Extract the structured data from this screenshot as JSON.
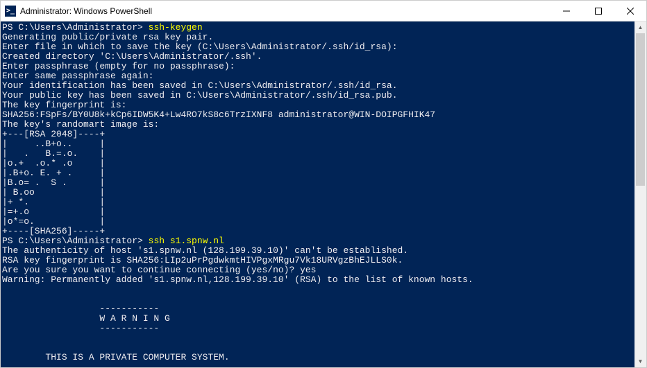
{
  "titlebar": {
    "icon_glyph": ">_",
    "title": "Administrator: Windows PowerShell"
  },
  "session": {
    "prompt1": "PS C:\\Users\\Administrator> ",
    "command1": "ssh-keygen",
    "output1_lines": [
      "Generating public/private rsa key pair.",
      "Enter file in which to save the key (C:\\Users\\Administrator/.ssh/id_rsa):",
      "Created directory 'C:\\Users\\Administrator/.ssh'.",
      "Enter passphrase (empty for no passphrase):",
      "Enter same passphrase again:",
      "Your identification has been saved in C:\\Users\\Administrator/.ssh/id_rsa.",
      "Your public key has been saved in C:\\Users\\Administrator/.ssh/id_rsa.pub.",
      "The key fingerprint is:",
      "SHA256:FSpFs/BY0U8k+kCp6IDW5K4+Lw4RO7kS8c6TrzIXNF8 administrator@WIN-DOIPGFHIK47",
      "The key's randomart image is:",
      "+---[RSA 2048]----+",
      "|     ..B+o..     |",
      "|   .   B.=.o.    |",
      "|o.+  .o.* .o     |",
      "|.B+o. E. + .     |",
      "|B.o= .  S .      |",
      "| B.oo            |",
      "|+ *.             |",
      "|=+.o             |",
      "|o*=o.            |",
      "+----[SHA256]-----+"
    ],
    "prompt2": "PS C:\\Users\\Administrator> ",
    "command2": "ssh s1.spnw.nl",
    "output2_lines": [
      "The authenticity of host 's1.spnw.nl (128.199.39.10)' can't be established.",
      "RSA key fingerprint is SHA256:LIp2uPrPgdwkmtHIVPgxMRgu7Vk18URVgzBhEJLLS0k.",
      "Are you sure you want to continue connecting (yes/no)? yes",
      "Warning: Permanently added 's1.spnw.nl,128.199.39.10' (RSA) to the list of known hosts.",
      "",
      "",
      "                  -----------",
      "                  W A R N I N G",
      "                  -----------",
      "",
      "",
      "        THIS IS A PRIVATE COMPUTER SYSTEM."
    ]
  }
}
